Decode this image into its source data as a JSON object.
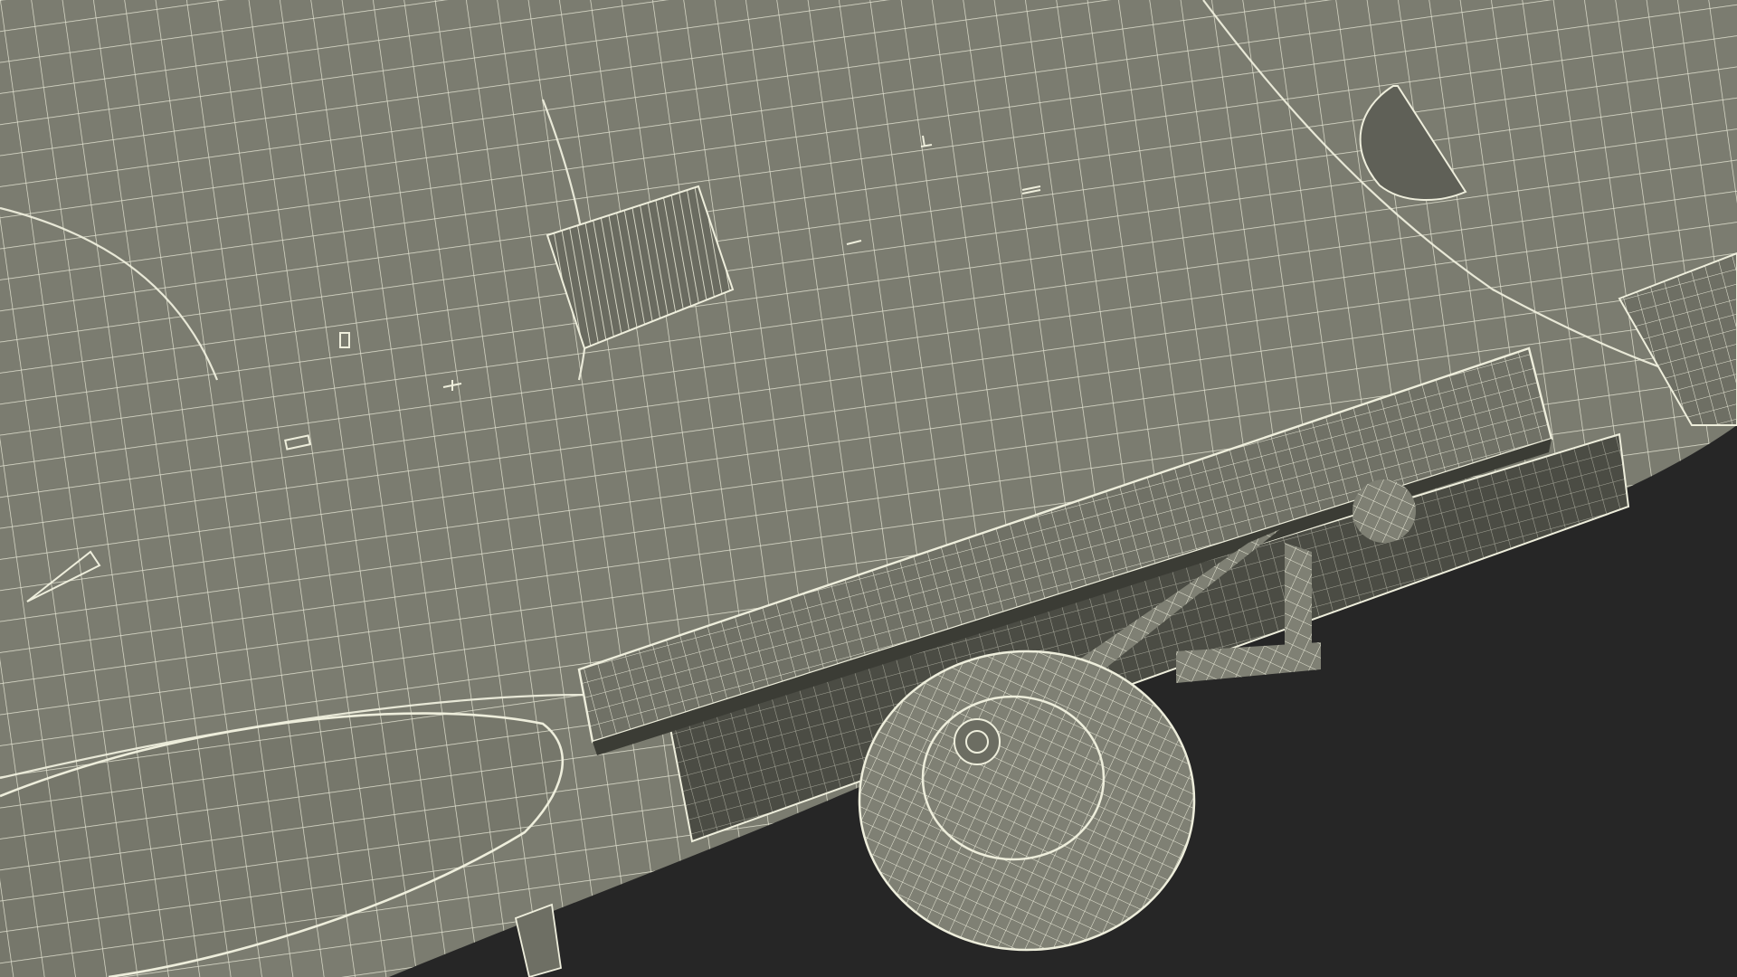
{
  "scene": {
    "subject": "aircraft-underside-wireframe",
    "render_style": "wireframe-over-shaded",
    "colors": {
      "background": "#262626",
      "fuselage": "#7b7c70",
      "fuselage_dark": "#55564d",
      "wire": "#eeeedc",
      "shadow": "#3b3c35"
    }
  }
}
